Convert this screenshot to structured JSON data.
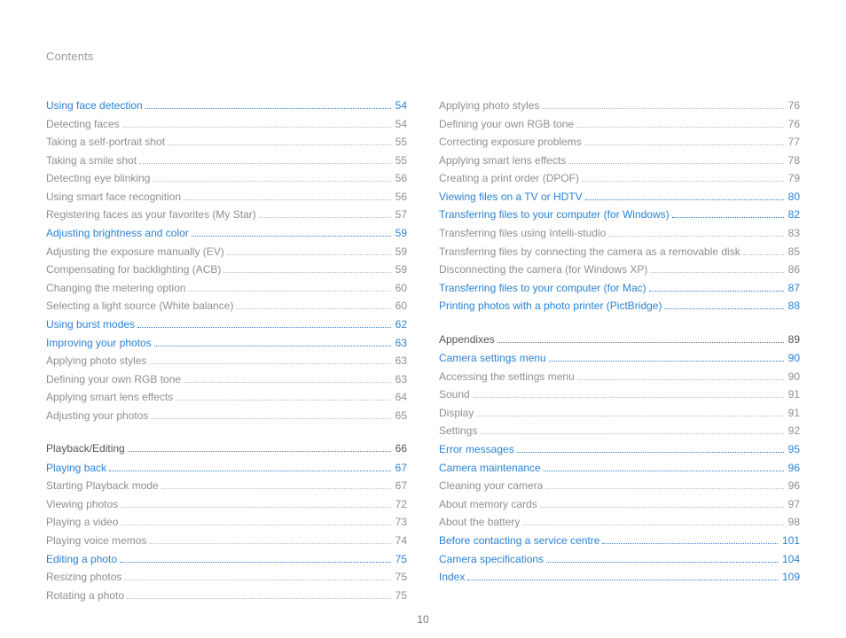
{
  "header": "Contents",
  "page_number": "10",
  "left": [
    {
      "t": "Using face detection",
      "p": "54",
      "k": "link",
      "cls": "first"
    },
    {
      "t": "Detecting faces",
      "p": "54",
      "k": "plain"
    },
    {
      "t": "Taking a self-portrait shot",
      "p": "55",
      "k": "plain"
    },
    {
      "t": "Taking a smile shot",
      "p": "55",
      "k": "plain"
    },
    {
      "t": "Detecting eye blinking",
      "p": "56",
      "k": "plain"
    },
    {
      "t": "Using smart face recognition",
      "p": "56",
      "k": "plain"
    },
    {
      "t": "Registering faces as your favorites (My Star)",
      "p": "57",
      "k": "plain"
    },
    {
      "t": "Adjusting brightness and color",
      "p": "59",
      "k": "link"
    },
    {
      "t": "Adjusting the exposure manually (EV)",
      "p": "59",
      "k": "plain"
    },
    {
      "t": "Compensating for backlighting (ACB)",
      "p": "59",
      "k": "plain"
    },
    {
      "t": "Changing the metering option",
      "p": "60",
      "k": "plain"
    },
    {
      "t": "Selecting a light source (White balance)",
      "p": "60",
      "k": "plain"
    },
    {
      "t": "Using burst modes",
      "p": "62",
      "k": "link"
    },
    {
      "t": "Improving your photos",
      "p": "63",
      "k": "link"
    },
    {
      "t": "Applying photo styles",
      "p": "63",
      "k": "plain"
    },
    {
      "t": "Defining your own RGB tone",
      "p": "63",
      "k": "plain"
    },
    {
      "t": "Applying smart lens effects",
      "p": "64",
      "k": "plain"
    },
    {
      "t": "Adjusting your photos",
      "p": "65",
      "k": "plain"
    },
    {
      "t": "Playback/Editing",
      "p": "66",
      "k": "section"
    },
    {
      "t": "Playing back",
      "p": "67",
      "k": "link"
    },
    {
      "t": "Starting Playback mode",
      "p": "67",
      "k": "plain"
    },
    {
      "t": "Viewing photos",
      "p": "72",
      "k": "plain"
    },
    {
      "t": "Playing a video",
      "p": "73",
      "k": "plain"
    },
    {
      "t": "Playing voice memos",
      "p": "74",
      "k": "plain"
    },
    {
      "t": "Editing a photo",
      "p": "75",
      "k": "link"
    },
    {
      "t": "Resizing photos",
      "p": "75",
      "k": "plain"
    },
    {
      "t": "Rotating a photo",
      "p": "75",
      "k": "plain"
    }
  ],
  "right": [
    {
      "t": "Applying photo styles",
      "p": "76",
      "k": "plain",
      "cls": "first"
    },
    {
      "t": "Defining your own RGB tone",
      "p": "76",
      "k": "plain"
    },
    {
      "t": "Correcting exposure problems",
      "p": "77",
      "k": "plain"
    },
    {
      "t": "Applying smart lens effects",
      "p": "78",
      "k": "plain"
    },
    {
      "t": "Creating a print order (DPOF)",
      "p": "79",
      "k": "plain"
    },
    {
      "t": "Viewing files on a TV or HDTV",
      "p": "80",
      "k": "link"
    },
    {
      "t": "Transferring files to your computer (for Windows)",
      "p": "82",
      "k": "link"
    },
    {
      "t": "Transferring files using Intelli-studio",
      "p": "83",
      "k": "plain"
    },
    {
      "t": "Transferring files by connecting the camera as a removable disk",
      "p": "85",
      "k": "plain"
    },
    {
      "t": "Disconnecting the camera (for Windows XP)",
      "p": "86",
      "k": "plain"
    },
    {
      "t": "Transferring files to your computer (for Mac)",
      "p": "87",
      "k": "link"
    },
    {
      "t": "Printing photos with a photo printer (PictBridge)",
      "p": "88",
      "k": "link"
    },
    {
      "t": "Appendixes",
      "p": "89",
      "k": "section"
    },
    {
      "t": "Camera settings menu",
      "p": "90",
      "k": "link"
    },
    {
      "t": "Accessing the settings menu",
      "p": "90",
      "k": "plain"
    },
    {
      "t": "Sound",
      "p": "91",
      "k": "plain"
    },
    {
      "t": "Display",
      "p": "91",
      "k": "plain"
    },
    {
      "t": "Settings",
      "p": "92",
      "k": "plain"
    },
    {
      "t": "Error messages",
      "p": "95",
      "k": "link"
    },
    {
      "t": "Camera maintenance",
      "p": "96",
      "k": "link"
    },
    {
      "t": "Cleaning your camera",
      "p": "96",
      "k": "plain"
    },
    {
      "t": "About memory cards",
      "p": "97",
      "k": "plain"
    },
    {
      "t": "About the battery",
      "p": "98",
      "k": "plain"
    },
    {
      "t": "Before contacting a service centre",
      "p": "101",
      "k": "link"
    },
    {
      "t": "Camera specifications",
      "p": "104",
      "k": "link"
    },
    {
      "t": "Index",
      "p": "109",
      "k": "link"
    }
  ]
}
